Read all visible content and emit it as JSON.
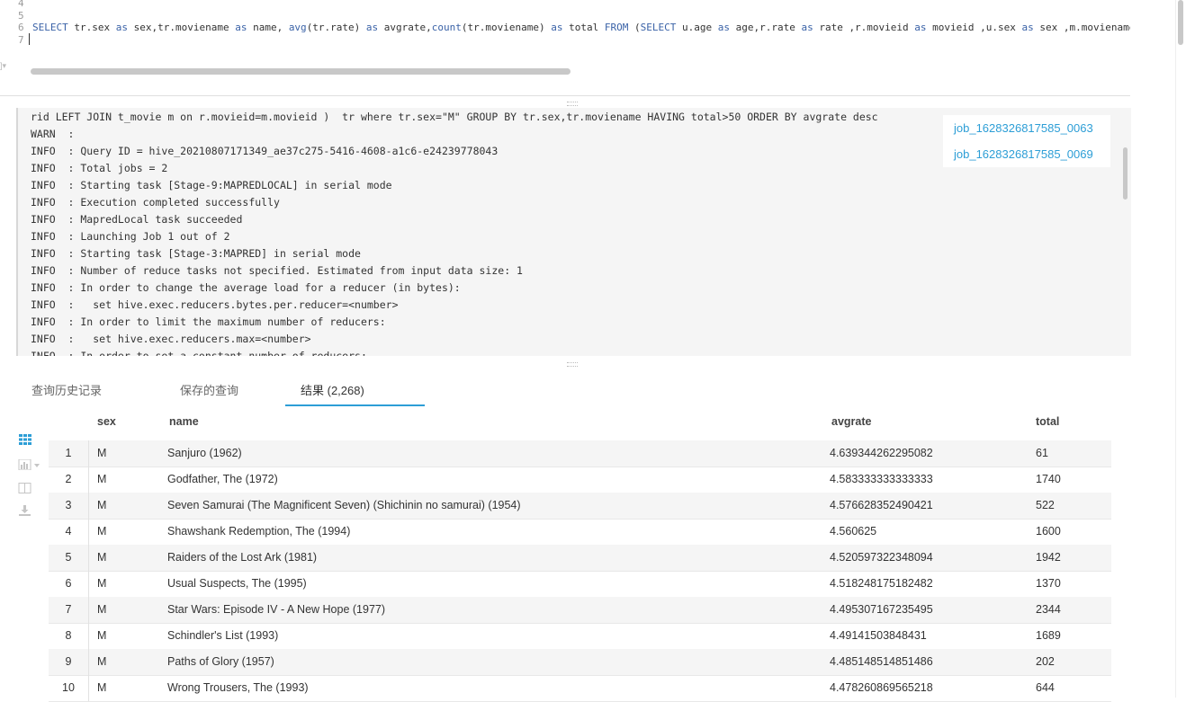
{
  "editor": {
    "line_numbers": [
      "4",
      "5",
      "6",
      "7"
    ],
    "code_tokens": [
      {
        "t": "SELECT",
        "k": "kw"
      },
      {
        "t": " tr.sex ",
        "k": ""
      },
      {
        "t": "as",
        "k": "kw"
      },
      {
        "t": " sex,tr.moviename ",
        "k": ""
      },
      {
        "t": "as",
        "k": "kw"
      },
      {
        "t": " name, ",
        "k": ""
      },
      {
        "t": "avg",
        "k": "fn"
      },
      {
        "t": "(tr.rate) ",
        "k": ""
      },
      {
        "t": "as",
        "k": "kw"
      },
      {
        "t": " avgrate,",
        "k": ""
      },
      {
        "t": "count",
        "k": "fn"
      },
      {
        "t": "(tr.moviename) ",
        "k": ""
      },
      {
        "t": "as",
        "k": "kw"
      },
      {
        "t": " total ",
        "k": ""
      },
      {
        "t": "FROM",
        "k": "kw"
      },
      {
        "t": " (",
        "k": ""
      },
      {
        "t": "SELECT",
        "k": "kw"
      },
      {
        "t": " u.age ",
        "k": ""
      },
      {
        "t": "as",
        "k": "kw"
      },
      {
        "t": " age,r.rate ",
        "k": ""
      },
      {
        "t": "as",
        "k": "kw"
      },
      {
        "t": " rate ,r.movieid ",
        "k": ""
      },
      {
        "t": "as",
        "k": "kw"
      },
      {
        "t": " movieid ,u.sex ",
        "k": ""
      },
      {
        "t": "as",
        "k": "kw"
      },
      {
        "t": " sex ,m.moviename",
        "k": ""
      }
    ]
  },
  "log": {
    "lines": [
      "rid LEFT JOIN t_movie m on r.movieid=m.movieid )  tr where tr.sex=\"M\" GROUP BY tr.sex,tr.moviename HAVING total>50 ORDER BY avgrate desc",
      "WARN  :",
      "INFO  : Query ID = hive_20210807171349_ae37c275-5416-4608-a1c6-e24239778043",
      "INFO  : Total jobs = 2",
      "INFO  : Starting task [Stage-9:MAPREDLOCAL] in serial mode",
      "INFO  : Execution completed successfully",
      "INFO  : MapredLocal task succeeded",
      "INFO  : Launching Job 1 out of 2",
      "INFO  : Starting task [Stage-3:MAPRED] in serial mode",
      "INFO  : Number of reduce tasks not specified. Estimated from input data size: 1",
      "INFO  : In order to change the average load for a reducer (in bytes):",
      "INFO  :   set hive.exec.reducers.bytes.per.reducer=<number>",
      "INFO  : In order to limit the maximum number of reducers:",
      "INFO  :   set hive.exec.reducers.max=<number>",
      "INFO  : In order to set a constant number of reducers:"
    ],
    "jobs": [
      "job_1628326817585_0063",
      "job_1628326817585_0069"
    ]
  },
  "tabs": {
    "history": "查询历史记录",
    "saved": "保存的查询",
    "results": "结果 (2,268)"
  },
  "side_icons": [
    "grid-icon",
    "chart-icon",
    "columns-icon",
    "download-icon"
  ],
  "table": {
    "headers": {
      "sex": "sex",
      "name": "name",
      "avgrate": "avgrate",
      "total": "total"
    },
    "rows": [
      {
        "idx": "1",
        "sex": "M",
        "name": "Sanjuro (1962)",
        "avgrate": "4.639344262295082",
        "total": "61"
      },
      {
        "idx": "2",
        "sex": "M",
        "name": "Godfather, The (1972)",
        "avgrate": "4.583333333333333",
        "total": "1740"
      },
      {
        "idx": "3",
        "sex": "M",
        "name": "Seven Samurai (The Magnificent Seven) (Shichinin no samurai) (1954)",
        "avgrate": "4.576628352490421",
        "total": "522"
      },
      {
        "idx": "4",
        "sex": "M",
        "name": "Shawshank Redemption, The (1994)",
        "avgrate": "4.560625",
        "total": "1600"
      },
      {
        "idx": "5",
        "sex": "M",
        "name": "Raiders of the Lost Ark (1981)",
        "avgrate": "4.520597322348094",
        "total": "1942"
      },
      {
        "idx": "6",
        "sex": "M",
        "name": "Usual Suspects, The (1995)",
        "avgrate": "4.518248175182482",
        "total": "1370"
      },
      {
        "idx": "7",
        "sex": "M",
        "name": "Star Wars: Episode IV - A New Hope (1977)",
        "avgrate": "4.495307167235495",
        "total": "2344"
      },
      {
        "idx": "8",
        "sex": "M",
        "name": "Schindler's List (1993)",
        "avgrate": "4.49141503848431",
        "total": "1689"
      },
      {
        "idx": "9",
        "sex": "M",
        "name": "Paths of Glory (1957)",
        "avgrate": "4.485148514851486",
        "total": "202"
      },
      {
        "idx": "10",
        "sex": "M",
        "name": "Wrong Trousers, The (1993)",
        "avgrate": "4.478260869565218",
        "total": "644"
      }
    ]
  }
}
